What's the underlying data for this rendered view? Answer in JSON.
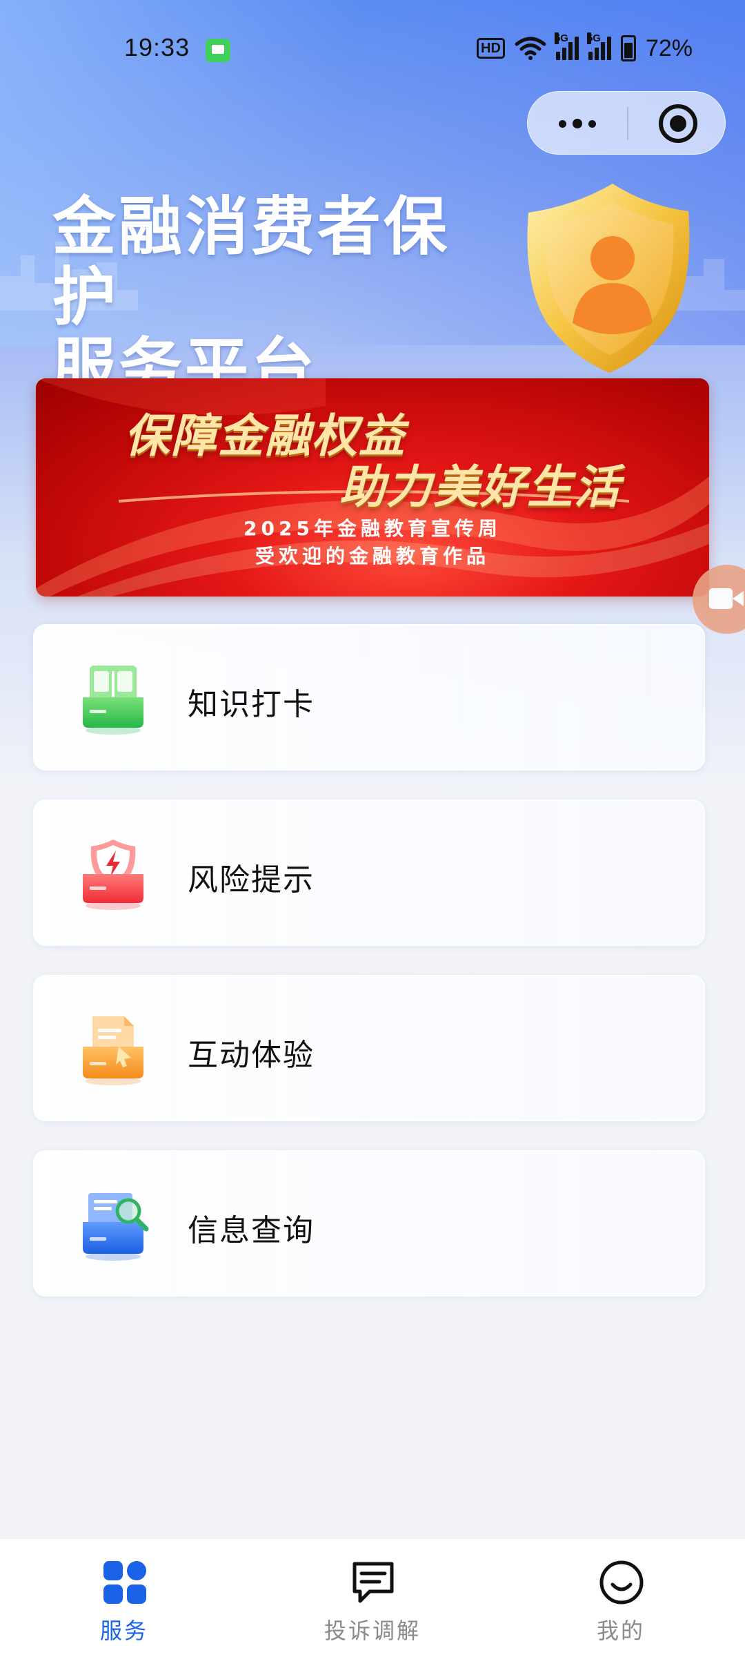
{
  "status_bar": {
    "time": "19:33",
    "hd_label": "HD",
    "network_labels": [
      "5G",
      "5G"
    ],
    "battery": "72%"
  },
  "capsule": {
    "more_icon": "more-dots-icon",
    "close_icon": "target-close-icon"
  },
  "hero": {
    "title_line1": "金融消费者保护",
    "title_line2": "服务平台",
    "emblem_icon": "shield-user-icon"
  },
  "banner": {
    "line1": "保障金融权益",
    "line2": "助力美好生活",
    "sub1": "2025年金融教育宣传周",
    "sub2": "受欢迎的金融教育作品"
  },
  "floating": {
    "icon": "video-camera-icon"
  },
  "menu": [
    {
      "label": "知识打卡",
      "icon": "book-icon"
    },
    {
      "label": "风险提示",
      "icon": "risk-alert-icon"
    },
    {
      "label": "互动体验",
      "icon": "interactive-envelope-icon"
    },
    {
      "label": "信息查询",
      "icon": "search-document-icon"
    }
  ],
  "bottom_nav": [
    {
      "label": "服务",
      "icon": "grid-icon",
      "active": true
    },
    {
      "label": "投诉调解",
      "icon": "chat-bubble-icon",
      "active": false
    },
    {
      "label": "我的",
      "icon": "smile-icon",
      "active": false
    }
  ],
  "colors": {
    "active": "#1a63e8",
    "inactive": "#8a8a8a",
    "banner_red": "#d80e0e",
    "gold": "#ffe6a8"
  }
}
